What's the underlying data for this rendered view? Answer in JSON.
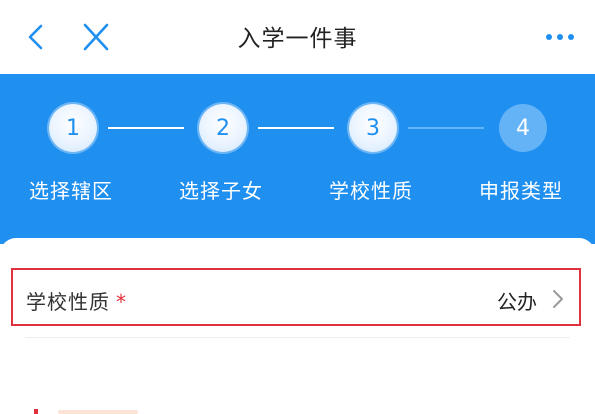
{
  "navbar": {
    "title": "入学一件事",
    "back_icon": "chevron-left-icon",
    "close_icon": "close-icon",
    "more_icon": "more-horizontal-icon"
  },
  "steps": [
    {
      "number": "1",
      "label": "选择辖区",
      "state": "done"
    },
    {
      "number": "2",
      "label": "选择子女",
      "state": "done"
    },
    {
      "number": "3",
      "label": "学校性质",
      "state": "current"
    },
    {
      "number": "4",
      "label": "申报类型",
      "state": "todo"
    }
  ],
  "form": {
    "school_type": {
      "label": "学校性质",
      "required_mark": "*",
      "value": "公办"
    }
  },
  "colors": {
    "primary": "#1f8ff0",
    "step_todo": "#64b3f6",
    "required": "#e0303c",
    "highlight_border": "#e0303c"
  }
}
